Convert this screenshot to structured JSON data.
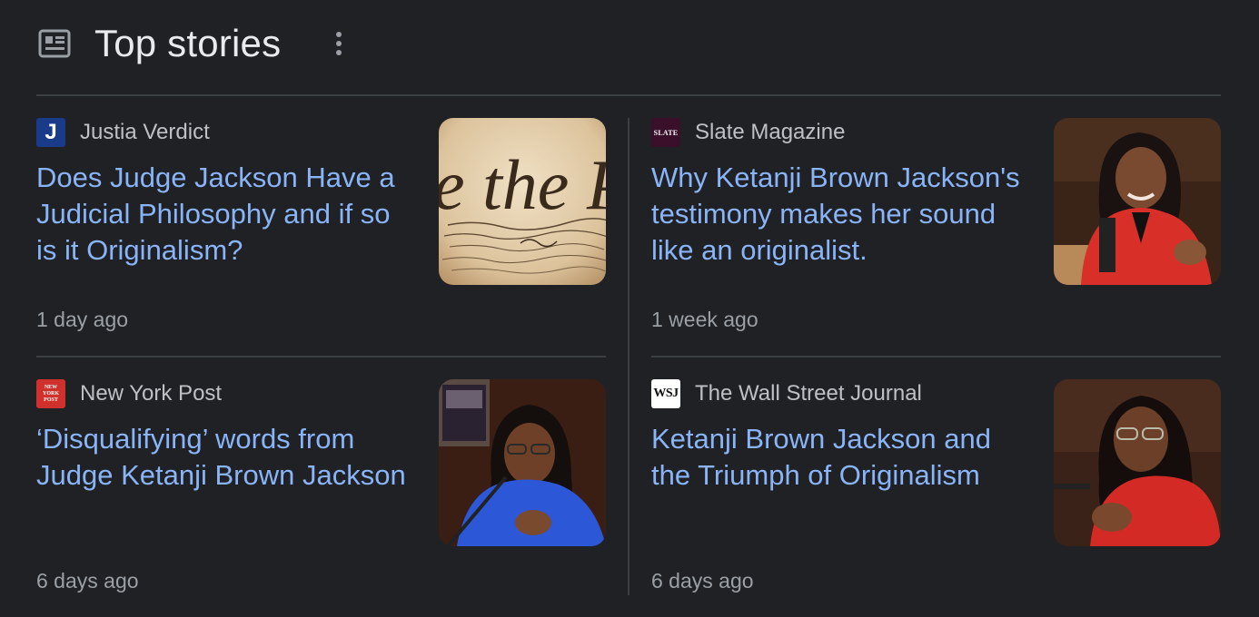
{
  "header": {
    "title": "Top stories",
    "icon": "newspaper-icon",
    "more_icon": "more-vert-icon"
  },
  "colors": {
    "background": "#202124",
    "title": "#e8eaed",
    "headline_link": "#8ab4f8",
    "source_text": "#bdc1c6",
    "time_text": "#9aa0a6",
    "divider": "#3c4043"
  },
  "stories": [
    {
      "source": "Justia Verdict",
      "source_logo_text": "J",
      "headline": "Does Judge Jackson Have a Judicial Philosophy and if so is it Originalism?",
      "time": "1 day ago",
      "thumbnail": "constitution-image"
    },
    {
      "source": "Slate Magazine",
      "source_logo_text": "SLATE",
      "headline": "Why Ketanji Brown Jackson's testimony makes her sound like an originalist.",
      "time": "1 week ago",
      "thumbnail": "ketanji-brown-jackson-red-jacket-image"
    },
    {
      "source": "New York Post",
      "source_logo_text": "NEW YORK POST",
      "headline": "‘Disqualifying’ words from Judge Ketanji Brown Jackson",
      "time": "6 days ago",
      "thumbnail": "ketanji-brown-jackson-blue-jacket-image"
    },
    {
      "source": "The Wall Street Journal",
      "source_logo_text": "WSJ",
      "headline": "Ketanji Brown Jackson and the Triumph of Originalism",
      "time": "6 days ago",
      "thumbnail": "ketanji-brown-jackson-hearing-image"
    }
  ]
}
